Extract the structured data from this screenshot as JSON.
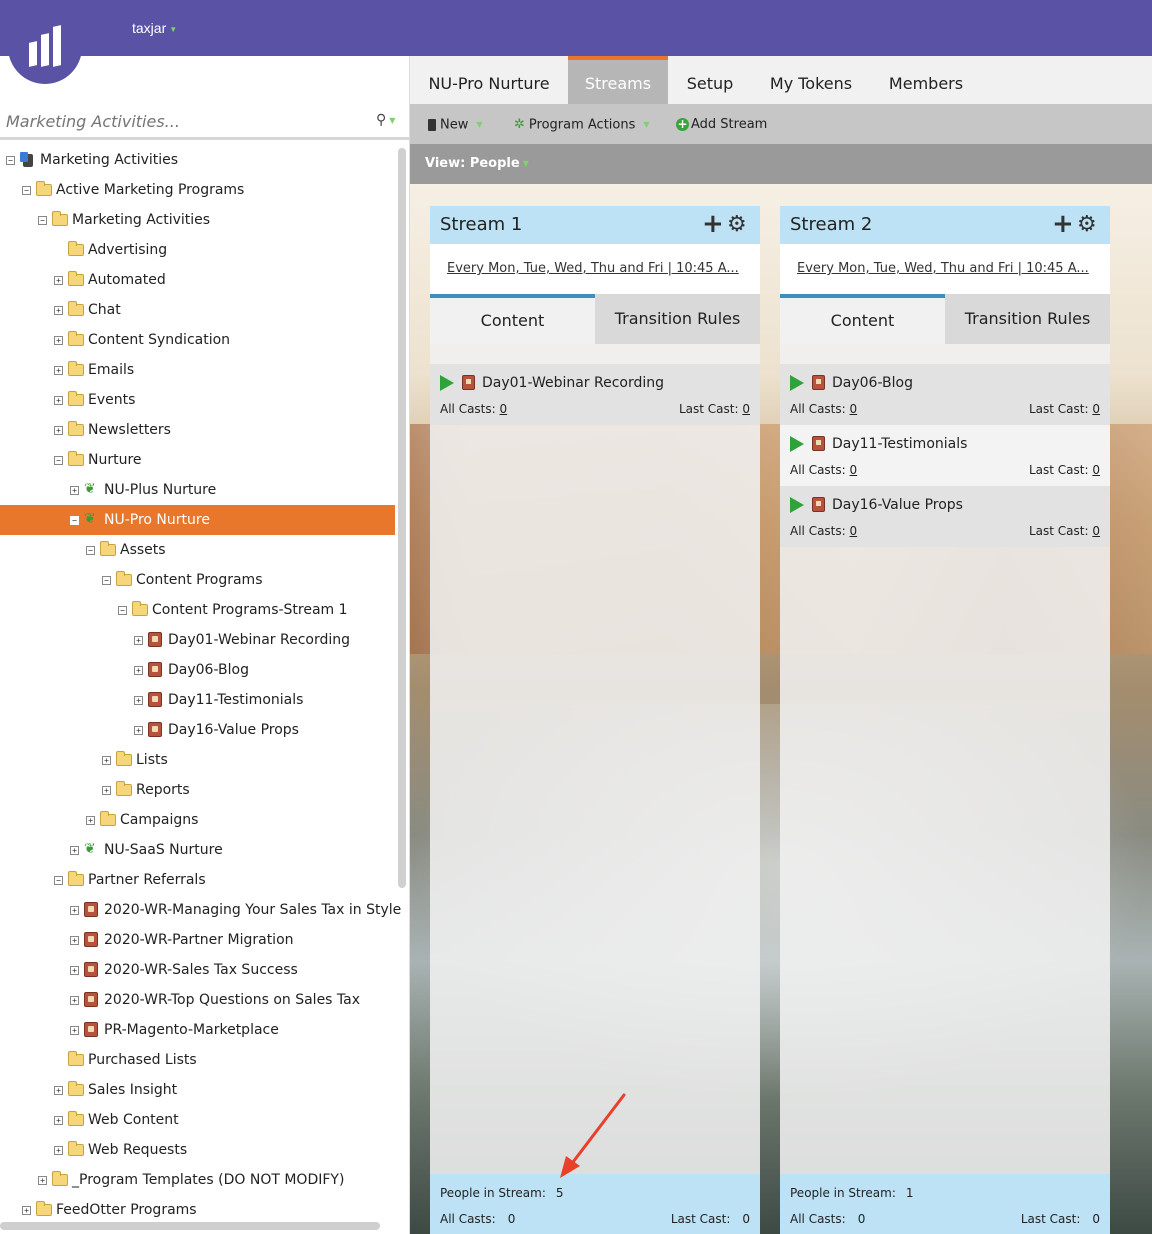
{
  "header": {
    "account_name": "taxjar",
    "logo": "marketo-bars-logo"
  },
  "left_panel": {
    "search_placeholder": "Marketing Activities...",
    "tree": [
      {
        "label": "Marketing Activities",
        "level": 0,
        "toggle": "−",
        "icon": "database-icon"
      },
      {
        "label": "Active Marketing Programs",
        "level": 1,
        "toggle": "−",
        "icon": "folder-icon"
      },
      {
        "label": "Marketing Activities",
        "level": 2,
        "toggle": "−",
        "icon": "folder-icon"
      },
      {
        "label": "Advertising",
        "level": 3,
        "toggle": "",
        "icon": "folder-icon"
      },
      {
        "label": "Automated",
        "level": 3,
        "toggle": "+",
        "icon": "folder-icon"
      },
      {
        "label": "Chat",
        "level": 3,
        "toggle": "+",
        "icon": "folder-icon"
      },
      {
        "label": "Content Syndication",
        "level": 3,
        "toggle": "+",
        "icon": "folder-icon"
      },
      {
        "label": "Emails",
        "level": 3,
        "toggle": "+",
        "icon": "folder-icon"
      },
      {
        "label": "Events",
        "level": 3,
        "toggle": "+",
        "icon": "folder-icon"
      },
      {
        "label": "Newsletters",
        "level": 3,
        "toggle": "+",
        "icon": "folder-icon"
      },
      {
        "label": "Nurture",
        "level": 3,
        "toggle": "−",
        "icon": "folder-icon"
      },
      {
        "label": "NU-Plus Nurture",
        "level": 4,
        "toggle": "+",
        "icon": "nurture-icon"
      },
      {
        "label": "NU-Pro Nurture",
        "level": 4,
        "toggle": "−",
        "icon": "nurture-icon",
        "selected": true
      },
      {
        "label": "Assets",
        "level": 5,
        "toggle": "−",
        "icon": "folder-icon"
      },
      {
        "label": "Content Programs",
        "level": 6,
        "toggle": "−",
        "icon": "folder-icon"
      },
      {
        "label": "Content Programs-Stream 1",
        "level": 7,
        "toggle": "−",
        "icon": "folder-icon"
      },
      {
        "label": "Day01-Webinar Recording",
        "level": 8,
        "toggle": "+",
        "icon": "program-icon"
      },
      {
        "label": "Day06-Blog",
        "level": 8,
        "toggle": "+",
        "icon": "program-icon"
      },
      {
        "label": "Day11-Testimonials",
        "level": 8,
        "toggle": "+",
        "icon": "program-icon"
      },
      {
        "label": "Day16-Value Props",
        "level": 8,
        "toggle": "+",
        "icon": "program-icon"
      },
      {
        "label": "Lists",
        "level": 6,
        "toggle": "+",
        "icon": "folder-icon"
      },
      {
        "label": "Reports",
        "level": 6,
        "toggle": "+",
        "icon": "folder-icon"
      },
      {
        "label": "Campaigns",
        "level": 5,
        "toggle": "+",
        "icon": "folder-icon"
      },
      {
        "label": "NU-SaaS Nurture",
        "level": 4,
        "toggle": "+",
        "icon": "nurture-icon"
      },
      {
        "label": "Partner Referrals",
        "level": 3,
        "toggle": "−",
        "icon": "folder-icon"
      },
      {
        "label": "2020-WR-Managing Your Sales Tax in Style",
        "level": 4,
        "toggle": "+",
        "icon": "program-icon"
      },
      {
        "label": "2020-WR-Partner Migration",
        "level": 4,
        "toggle": "+",
        "icon": "program-icon"
      },
      {
        "label": "2020-WR-Sales Tax Success",
        "level": 4,
        "toggle": "+",
        "icon": "program-icon"
      },
      {
        "label": "2020-WR-Top Questions on Sales Tax",
        "level": 4,
        "toggle": "+",
        "icon": "program-icon"
      },
      {
        "label": "PR-Magento-Marketplace",
        "level": 4,
        "toggle": "+",
        "icon": "program-icon"
      },
      {
        "label": "Purchased Lists",
        "level": 3,
        "toggle": "",
        "icon": "folder-icon"
      },
      {
        "label": "Sales Insight",
        "level": 3,
        "toggle": "+",
        "icon": "folder-icon"
      },
      {
        "label": "Web Content",
        "level": 3,
        "toggle": "+",
        "icon": "folder-icon"
      },
      {
        "label": "Web Requests",
        "level": 3,
        "toggle": "+",
        "icon": "folder-icon"
      },
      {
        "label": "_Program Templates (DO NOT MODIFY)",
        "level": 2,
        "toggle": "+",
        "icon": "folder-icon"
      },
      {
        "label": "FeedOtter Programs",
        "level": 1,
        "toggle": "+",
        "icon": "folder-icon"
      }
    ]
  },
  "tabs": [
    {
      "label": "NU-Pro Nurture",
      "active": false
    },
    {
      "label": "Streams",
      "active": true
    },
    {
      "label": "Setup",
      "active": false
    },
    {
      "label": "My Tokens",
      "active": false
    },
    {
      "label": "Members",
      "active": false
    }
  ],
  "toolbar": {
    "new_label": "New",
    "program_actions_label": "Program Actions",
    "add_stream_label": "Add Stream"
  },
  "view": {
    "label": "View: People"
  },
  "streams": [
    {
      "title": "Stream 1",
      "schedule": "Every Mon, Tue, Wed, Thu and Fri | 10:45 A...",
      "content_tab": "Content",
      "rules_tab": "Transition Rules",
      "items": [
        {
          "name": "Day01-Webinar Recording",
          "all_casts_label": "All Casts:",
          "all_casts": "0",
          "last_cast_label": "Last Cast:",
          "last_cast": "0"
        }
      ],
      "footer": {
        "people_label": "People in Stream:",
        "people": "5",
        "all_casts_label": "All Casts:",
        "all_casts": "0",
        "last_cast_label": "Last Cast:",
        "last_cast": "0"
      }
    },
    {
      "title": "Stream 2",
      "schedule": "Every Mon, Tue, Wed, Thu and Fri | 10:45 A...",
      "content_tab": "Content",
      "rules_tab": "Transition Rules",
      "items": [
        {
          "name": "Day06-Blog",
          "all_casts_label": "All Casts:",
          "all_casts": "0",
          "last_cast_label": "Last Cast:",
          "last_cast": "0"
        },
        {
          "name": "Day11-Testimonials",
          "all_casts_label": "All Casts:",
          "all_casts": "0",
          "last_cast_label": "Last Cast:",
          "last_cast": "0"
        },
        {
          "name": "Day16-Value Props",
          "all_casts_label": "All Casts:",
          "all_casts": "0",
          "last_cast_label": "Last Cast:",
          "last_cast": "0"
        }
      ],
      "footer": {
        "people_label": "People in Stream:",
        "people": "1",
        "all_casts_label": "All Casts:",
        "all_casts": "0",
        "last_cast_label": "Last Cast:",
        "last_cast": "0"
      }
    }
  ],
  "colors": {
    "brand": "#5a52a5",
    "accent": "#e8762b",
    "stream_header": "#bde2f5",
    "annotation_arrow": "#e8402a"
  }
}
